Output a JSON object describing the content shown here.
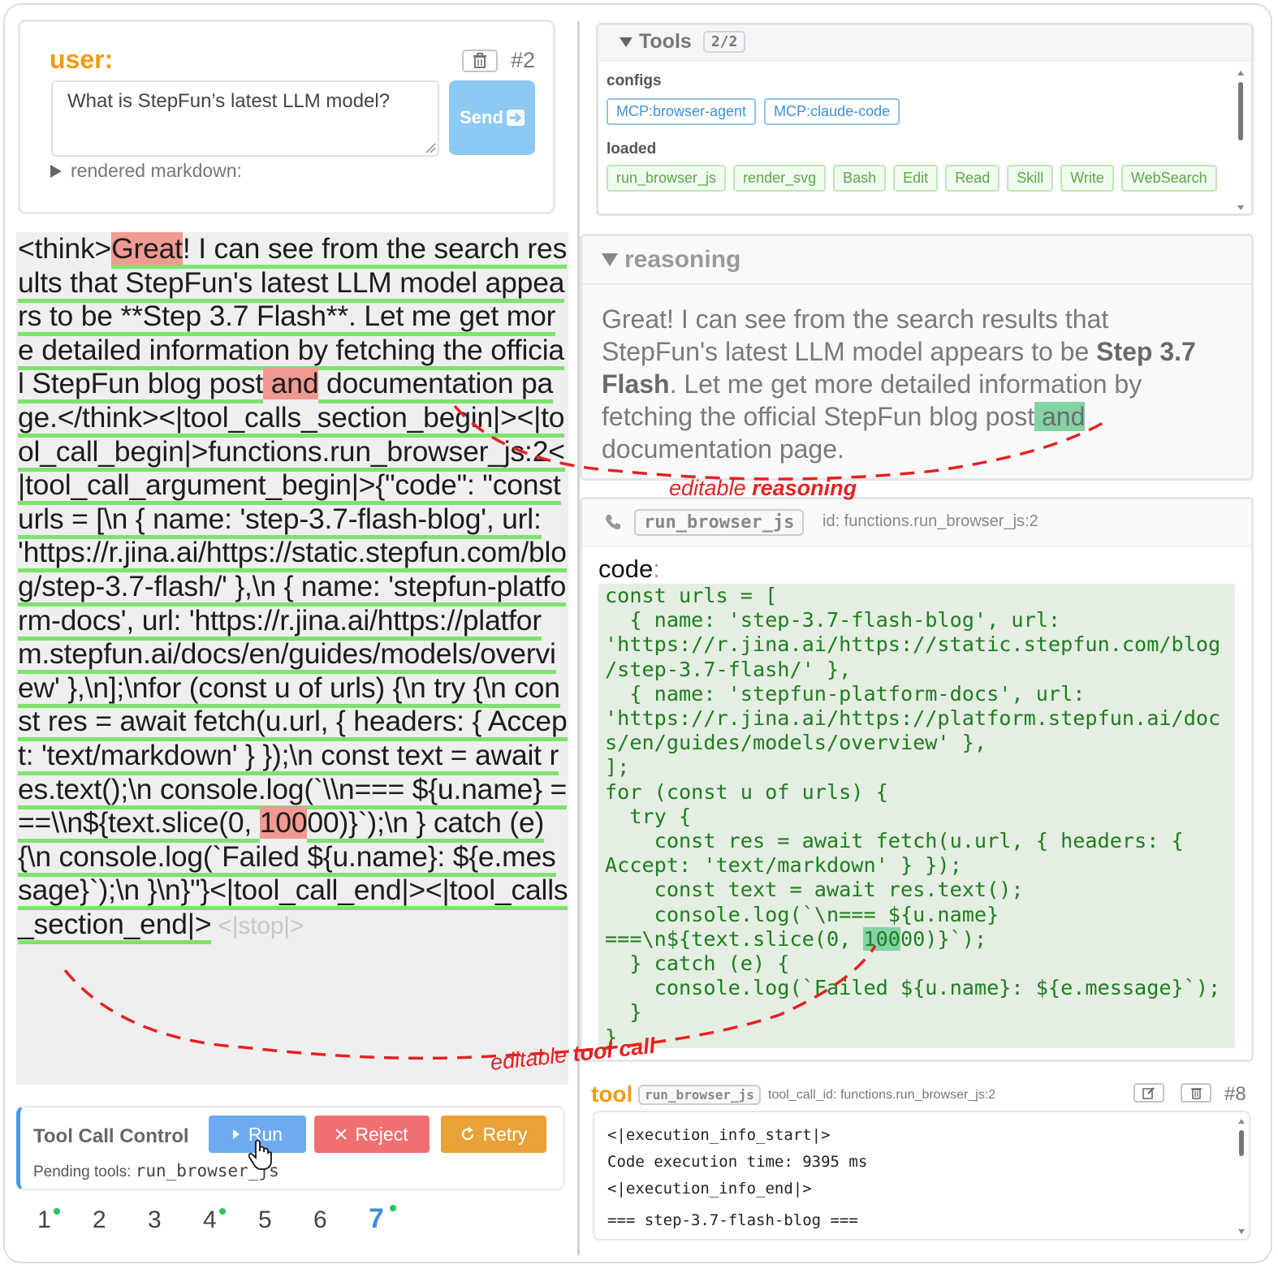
{
  "user_card": {
    "role_label": "user:",
    "message_number": "#2",
    "input_value": "What is StepFun’s latest LLM model?",
    "send_label": "Send",
    "rendered_toggle_label": "rendered markdown:"
  },
  "raw_panel": {
    "tokens": [
      {
        "t": "<think>"
      },
      {
        "t": "Great",
        "cls": "tk hl-red"
      },
      {
        "t": "!",
        "cls": "tk"
      },
      {
        "t": " I",
        "cls": "tk"
      },
      {
        "t": " can see from the search results that StepFun's latest LLM model appears to be **Step 3.7 Flash**. Let me get more detailed information by fetching the official StepFun blog post",
        "cls": "tk"
      },
      {
        "t": " and",
        "cls": "hl-red"
      },
      {
        "t": " documentation page.",
        "cls": "tk"
      },
      {
        "t": "</think><|tool_calls_section_begin|><|tool_call_begin|>functions.run_browser_js:2<|tool_call_argument_begin|>{\"code\": \"const urls = [\\n  { name: 'step-3.7-flash-blog', url: 'https://r.jina.ai/https://static.stepfun.com/blog/step-3.7-flash/' },\\n  { name: 'stepfun-platform-docs', url: 'https://r.jina.ai/https://platform.stepfun.ai/docs/en/guides/models/overview' },\\n];\\nfor (const u of urls) {\\n  try {\\n    const res = await fetch(u.url, { headers: { Accept: 'text/markdown' } });\\n    const text = await res.text();\\n    console.log(`\\\\n=== ${u.name} ===\\\\n${text.slice(0, ",
        "cls": "tk"
      },
      {
        "t": "100",
        "cls": "hl-red"
      },
      {
        "t": "00)}`);\\n  } catch (e) {\\n    console.log(`Failed ${u.name}: ${e.message}`);\\n  }\\n}\"}<|tool_call_end|><|tool_calls_section_end|>",
        "cls": "tk"
      },
      {
        "t": " <|stop|>",
        "cls": "stop"
      }
    ]
  },
  "tool_call_control": {
    "title": "Tool Call Control",
    "run_label": "Run",
    "reject_label": "Reject",
    "retry_label": "Retry",
    "pending_label": "Pending tools:",
    "pending_value": "run_browser_js"
  },
  "pager": {
    "pages": [
      {
        "label": "1",
        "dot": true
      },
      {
        "label": "2",
        "dot": false
      },
      {
        "label": "3",
        "dot": false
      },
      {
        "label": "4",
        "dot": true
      },
      {
        "label": "5",
        "dot": false
      },
      {
        "label": "6",
        "dot": false
      },
      {
        "label": "7",
        "dot": true,
        "active": true
      }
    ]
  },
  "tools_card": {
    "title": "Tools",
    "count": "2/2",
    "configs_label": "configs",
    "configs": [
      "MCP:browser-agent",
      "MCP:claude-code"
    ],
    "loaded_label": "loaded",
    "loaded": [
      "run_browser_js",
      "render_svg",
      "Bash",
      "Edit",
      "Read",
      "Skill",
      "Write",
      "WebSearch"
    ]
  },
  "reasoning": {
    "title": "reasoning",
    "text_a": "Great! I can see from the search results that StepFun's latest LLM model appears to be ",
    "bold": "Step 3.7 Flash",
    "text_b": ". Let me get more detailed information by fetching the official StepFun blog post",
    "highlight": " and",
    "text_c": " documentation page."
  },
  "tool_call": {
    "name": "run_browser_js",
    "id_text": "id: functions.run_browser_js:2",
    "code_label": "code",
    "code_before": "const urls = [\n  { name: 'step-3.7-flash-blog', url:\n'https://r.jina.ai/https://static.stepfun.com/blog\n/step-3.7-flash/' },\n  { name: 'stepfun-platform-docs', url:\n'https://r.jina.ai/https://platform.stepfun.ai/doc\ns/en/guides/models/overview' },\n];\nfor (const u of urls) {\n  try {\n    const res = await fetch(u.url, { headers: {\nAccept: 'text/markdown' } });\n    const text = await res.text();\n    console.log(`\\n=== ${u.name}\n===\\n${text.slice(0, ",
    "code_highlight": "100",
    "code_after": "00)}`);\n  } catch (e) {\n    console.log(`Failed ${u.name}: ${e.message}`);\n  }\n}"
  },
  "tool_result": {
    "label": "tool",
    "name": "run_browser_js",
    "call_id": "tool_call_id: functions.run_browser_js:2",
    "number": "#8",
    "lines": [
      "<|execution_info_start|>",
      "Code execution time: 9395 ms",
      "<|execution_info_end|>",
      "",
      "=== step-3.7-flash-blog ==="
    ]
  },
  "annotations": {
    "reasoning_a": "editable ",
    "reasoning_b": "reasoning",
    "toolcall_a": "editable ",
    "toolcall_b": "tool call"
  },
  "colors": {
    "accent_orange": "#f29b13",
    "token_underline": "#7de36d",
    "token_highlight_red": "#f19a92",
    "highlight_green": "#83d3a4",
    "annotation_red": "#e42222"
  }
}
